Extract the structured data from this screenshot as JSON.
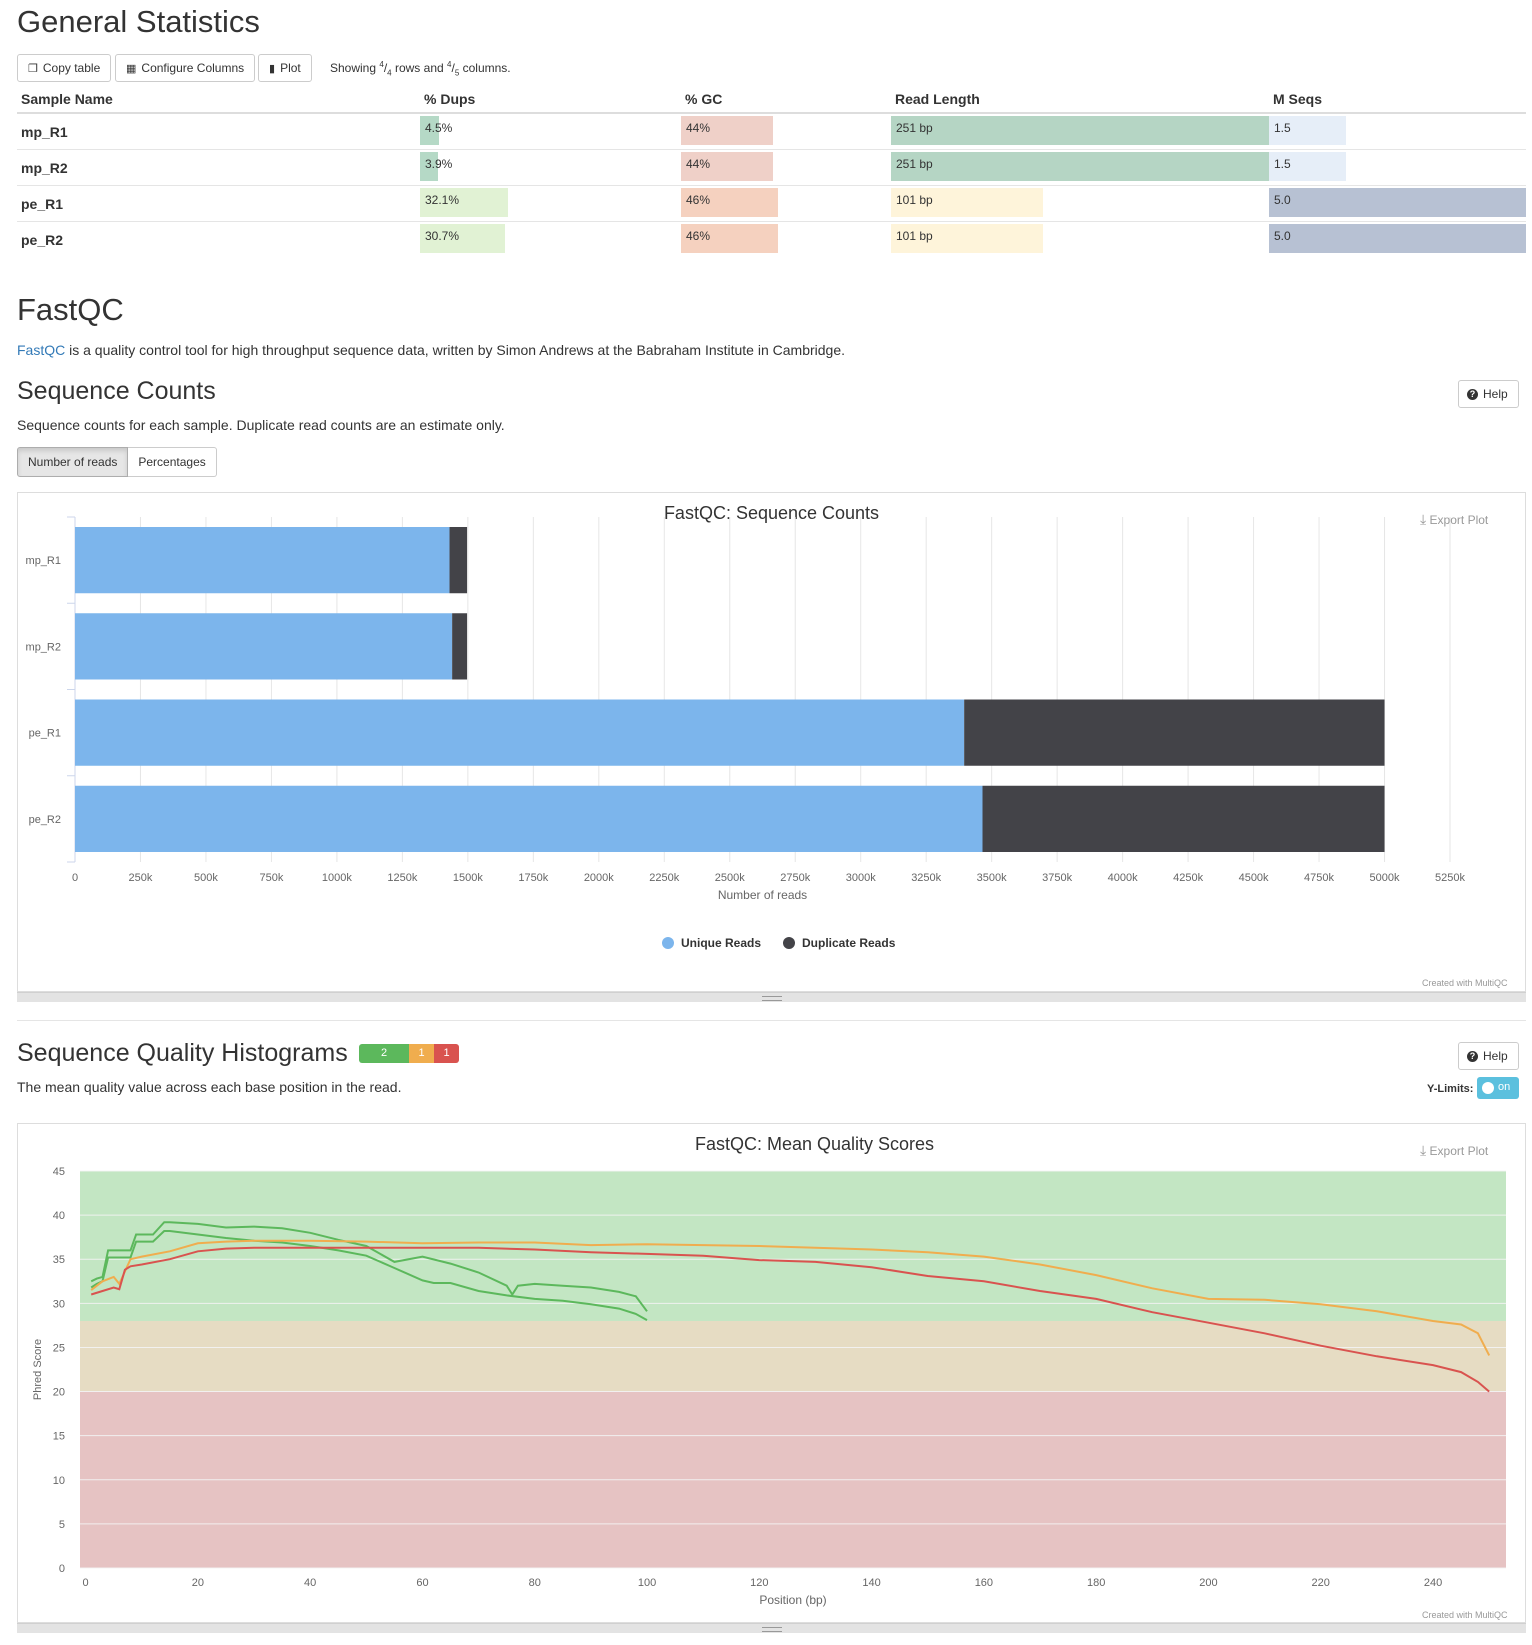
{
  "general": {
    "title": "General Statistics",
    "buttons": {
      "copy": "Copy table",
      "configure": "Configure Columns",
      "plot": "Plot"
    },
    "showing": {
      "prefix": "Showing",
      "rows_num": "4",
      "rows_den": "4",
      "mid": "rows and",
      "cols_num": "4",
      "cols_den": "5",
      "suffix": "columns."
    },
    "columns": [
      "Sample Name",
      "% Dups",
      "% GC",
      "Read Length",
      "M Seqs"
    ],
    "rows": [
      {
        "name": "mp_R1",
        "dups": "4.5%",
        "dups_frac": 0.045,
        "gc": "44%",
        "gc_frac": 0.44,
        "len": "251 bp",
        "len_frac": 1.0,
        "mseqs": "1.5",
        "mseqs_frac": 0.3
      },
      {
        "name": "mp_R2",
        "dups": "3.9%",
        "dups_frac": 0.039,
        "gc": "44%",
        "gc_frac": 0.44,
        "len": "251 bp",
        "len_frac": 1.0,
        "mseqs": "1.5",
        "mseqs_frac": 0.3
      },
      {
        "name": "pe_R1",
        "dups": "32.1%",
        "dups_frac": 0.321,
        "gc": "46%",
        "gc_frac": 0.46,
        "len": "101 bp",
        "len_frac": 0.402,
        "mseqs": "5.0",
        "mseqs_frac": 1.0
      },
      {
        "name": "pe_R2",
        "dups": "30.7%",
        "dups_frac": 0.307,
        "gc": "46%",
        "gc_frac": 0.46,
        "len": "101 bp",
        "len_frac": 0.402,
        "mseqs": "5.0",
        "mseqs_frac": 1.0
      }
    ],
    "colors": {
      "dups_low": "#b5d9c6",
      "dups_high": "#e1f2d4",
      "gc_low": "#efd0c8",
      "gc_high": "#f5d1bf",
      "len_high": "#b5d5c4",
      "len_low": "#fef4da",
      "mseqs_low": "#e6eef8",
      "mseqs_high": "#b7c1d3"
    }
  },
  "fastqc": {
    "title": "FastQC",
    "link_text": "FastQC",
    "description": "is a quality control tool for high throughput sequence data, written by Simon Andrews at the Babraham Institute in Cambridge."
  },
  "seq_counts": {
    "title": "Sequence Counts",
    "help": "Help",
    "description": "Sequence counts for each sample. Duplicate read counts are an estimate only.",
    "toggles": [
      "Number of reads",
      "Percentages"
    ],
    "export": "Export Plot",
    "credit": "Created with MultiQC"
  },
  "seq_quality": {
    "title": "Sequence Quality Histograms",
    "badges": [
      {
        "label": "2",
        "color": "#5cb85c"
      },
      {
        "label": "1",
        "color": "#f0ad4e"
      },
      {
        "label": "1",
        "color": "#d9534f"
      }
    ],
    "help": "Help",
    "description": "The mean quality value across each base position in the read.",
    "ylimits_label": "Y-Limits:",
    "toggle_label": "on",
    "export": "Export Plot",
    "credit": "Created with MultiQC"
  },
  "chart_data": [
    {
      "type": "bar",
      "orientation": "horizontal",
      "title": "FastQC: Sequence Counts",
      "xlabel": "Number of reads",
      "xlim": [
        0,
        5250000
      ],
      "xticks": [
        "0",
        "250k",
        "500k",
        "750k",
        "1000k",
        "1250k",
        "1500k",
        "1750k",
        "2000k",
        "2250k",
        "2500k",
        "2750k",
        "3000k",
        "3250k",
        "3500k",
        "3750k",
        "4000k",
        "4250k",
        "4500k",
        "4750k",
        "5000k",
        "5250k"
      ],
      "categories": [
        "mp_R1",
        "mp_R2",
        "pe_R1",
        "pe_R2"
      ],
      "series": [
        {
          "name": "Unique Reads",
          "color": "#7cb5ec",
          "values": [
            1430000,
            1440000,
            3395000,
            3465000
          ]
        },
        {
          "name": "Duplicate Reads",
          "color": "#434348",
          "values": [
            67000,
            57000,
            1605000,
            1535000
          ]
        }
      ],
      "legend": "bottom-center",
      "grid": true
    },
    {
      "type": "line",
      "title": "FastQC: Mean Quality Scores",
      "xlabel": "Position (bp)",
      "ylabel": "Phred Score",
      "xlim": [
        -1,
        253
      ],
      "ylim": [
        0,
        45
      ],
      "xticks": [
        0,
        20,
        40,
        60,
        80,
        100,
        120,
        140,
        160,
        180,
        200,
        220,
        240
      ],
      "yticks": [
        0,
        5,
        10,
        15,
        20,
        25,
        30,
        35,
        40,
        45
      ],
      "bands": [
        {
          "from": 28,
          "to": 45,
          "color": "#c3e6c3"
        },
        {
          "from": 20,
          "to": 28,
          "color": "#e6dcc3"
        },
        {
          "from": 0,
          "to": 20,
          "color": "#e6c3c3"
        }
      ],
      "series": [
        {
          "color": "#5cb85c",
          "x": [
            1,
            2,
            3,
            4,
            5,
            6,
            7,
            8,
            9,
            10,
            12,
            14,
            15,
            20,
            25,
            30,
            35,
            40,
            45,
            50,
            55,
            60,
            65,
            70,
            75,
            76,
            77,
            80,
            85,
            90,
            95,
            98,
            100
          ],
          "y": [
            32.5,
            32.8,
            33,
            36,
            36,
            36,
            36,
            36,
            37.8,
            37.8,
            37.8,
            39.2,
            39.2,
            39,
            38.6,
            38.7,
            38.5,
            38,
            37.2,
            36.5,
            34.7,
            35.3,
            34.5,
            33.5,
            32,
            31,
            32,
            32.2,
            32,
            31.8,
            31.3,
            30.8,
            29.1
          ]
        },
        {
          "color": "#5cb85c",
          "x": [
            1,
            2,
            3,
            4,
            5,
            6,
            7,
            8,
            9,
            10,
            12,
            14,
            15,
            20,
            25,
            30,
            35,
            40,
            45,
            50,
            55,
            60,
            62,
            65,
            70,
            75,
            80,
            85,
            90,
            95,
            98,
            100
          ],
          "y": [
            31.8,
            32.2,
            32.5,
            35.2,
            35.2,
            35.2,
            35.2,
            35.2,
            37,
            37,
            37,
            38.2,
            38.2,
            37.8,
            37.4,
            37.1,
            36.9,
            36.5,
            36,
            35.4,
            34,
            32.6,
            32.3,
            32.3,
            31.4,
            30.9,
            30.5,
            30.3,
            29.9,
            29.4,
            28.8,
            28.1
          ]
        },
        {
          "color": "#f0ad4e",
          "x": [
            1,
            3,
            5,
            6,
            8,
            10,
            15,
            20,
            25,
            30,
            40,
            50,
            60,
            70,
            80,
            90,
            100,
            110,
            120,
            130,
            140,
            150,
            160,
            170,
            180,
            190,
            200,
            210,
            220,
            230,
            240,
            245,
            248,
            250
          ],
          "y": [
            31.5,
            32.5,
            33,
            32.2,
            35,
            35.3,
            35.9,
            36.8,
            37,
            37.1,
            37.1,
            37,
            36.8,
            36.9,
            36.9,
            36.6,
            36.7,
            36.6,
            36.5,
            36.3,
            36.1,
            35.8,
            35.3,
            34.4,
            33.2,
            31.7,
            30.5,
            30.4,
            29.9,
            29.1,
            28,
            27.6,
            26.6,
            24.1
          ]
        },
        {
          "color": "#d9534f",
          "x": [
            1,
            3,
            5,
            6,
            7,
            8,
            10,
            15,
            20,
            25,
            30,
            40,
            50,
            60,
            70,
            80,
            90,
            100,
            110,
            120,
            130,
            140,
            150,
            160,
            170,
            180,
            190,
            200,
            210,
            220,
            230,
            240,
            245,
            248,
            250
          ],
          "y": [
            31,
            31.4,
            31.8,
            31.6,
            33.8,
            34.2,
            34.4,
            35,
            35.9,
            36.2,
            36.3,
            36.3,
            36.3,
            36.3,
            36.3,
            36.1,
            35.8,
            35.6,
            35.4,
            34.9,
            34.7,
            34.1,
            33.1,
            32.5,
            31.4,
            30.5,
            29,
            27.8,
            26.6,
            25.2,
            24,
            23,
            22.2,
            21.1,
            20
          ]
        }
      ],
      "grid": true
    }
  ]
}
